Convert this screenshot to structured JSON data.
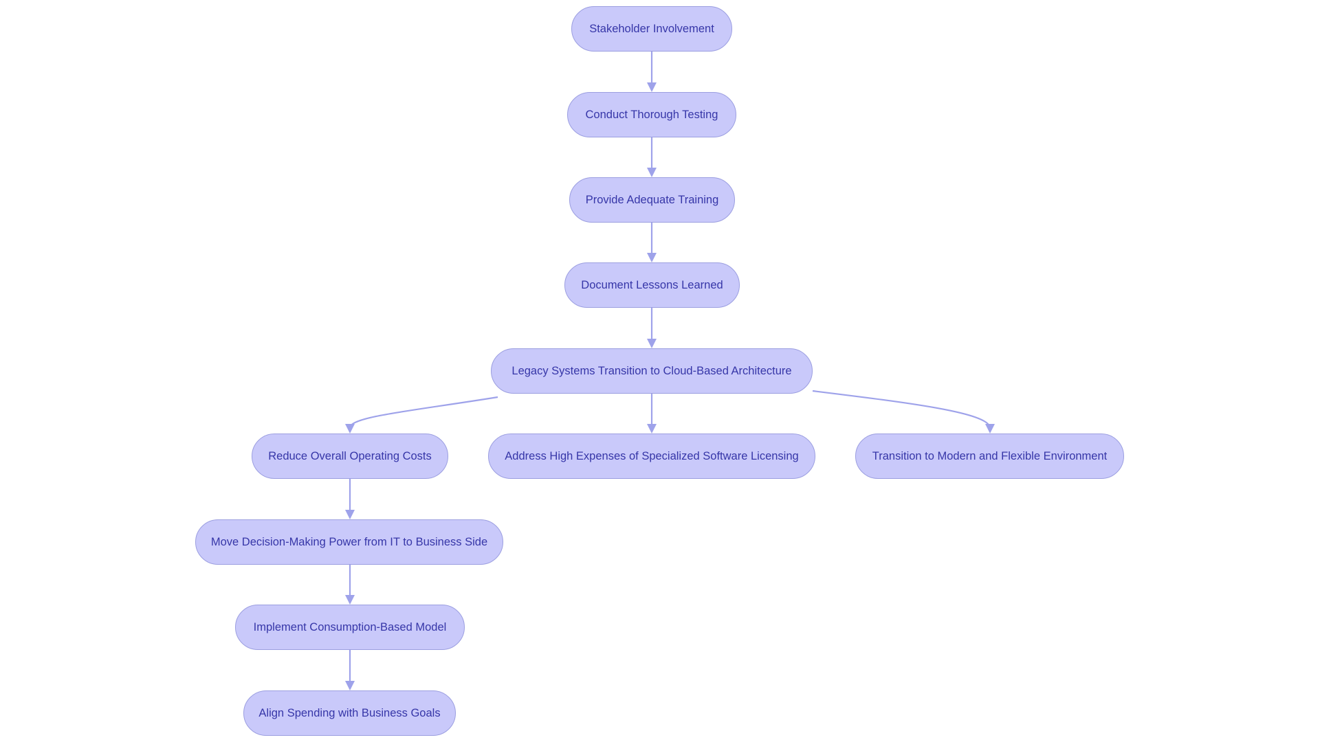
{
  "diagram": {
    "type": "flowchart",
    "direction": "top-down",
    "colors": {
      "node_fill": "#c9c9fa",
      "node_stroke": "#9b9ee0",
      "node_text": "#3636a8",
      "edge": "#9ea2ea",
      "background": "#ffffff"
    },
    "nodes": [
      {
        "id": "stakeholder",
        "label": "Stakeholder Involvement"
      },
      {
        "id": "testing",
        "label": "Conduct Thorough Testing"
      },
      {
        "id": "training",
        "label": "Provide Adequate Training"
      },
      {
        "id": "lessons",
        "label": "Document Lessons Learned"
      },
      {
        "id": "legacy",
        "label": "Legacy Systems Transition to Cloud-Based Architecture"
      },
      {
        "id": "reduce",
        "label": "Reduce Overall Operating Costs"
      },
      {
        "id": "address",
        "label": "Address High Expenses of Specialized Software Licensing"
      },
      {
        "id": "transition",
        "label": "Transition to Modern and Flexible Environment"
      },
      {
        "id": "move",
        "label": "Move Decision-Making Power from IT to Business Side"
      },
      {
        "id": "implement",
        "label": "Implement Consumption-Based Model"
      },
      {
        "id": "align",
        "label": "Align Spending with Business Goals"
      }
    ],
    "edges": [
      {
        "from": "stakeholder",
        "to": "testing"
      },
      {
        "from": "testing",
        "to": "training"
      },
      {
        "from": "training",
        "to": "lessons"
      },
      {
        "from": "lessons",
        "to": "legacy"
      },
      {
        "from": "legacy",
        "to": "reduce"
      },
      {
        "from": "legacy",
        "to": "address"
      },
      {
        "from": "legacy",
        "to": "transition"
      },
      {
        "from": "reduce",
        "to": "move"
      },
      {
        "from": "move",
        "to": "implement"
      },
      {
        "from": "implement",
        "to": "align"
      }
    ]
  }
}
